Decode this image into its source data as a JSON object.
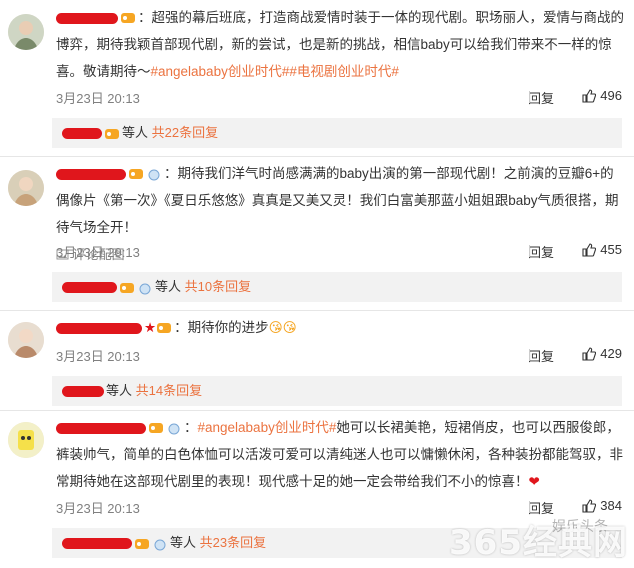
{
  "comments": [
    {
      "text_a": "：超强的幕后班底，打造商战爱情时装于一体的现代剧。职场丽人，爱情与商战的博弈，期待我颖首部现代剧，新的尝试，也是新的挑战，相信baby可以给我们带来不一样的惊喜。敬请期待～",
      "tags": [
        "#angelababy创业时代#",
        "#电视剧创业时代#"
      ],
      "time": "3月23日 20:13",
      "reply_label": "回复",
      "likes": "496",
      "reply_box": {
        "prefix": "等人",
        "count": "共22条回复"
      }
    },
    {
      "text_a": "：期待我们洋气时尚感满满的baby出演的第一部现代剧！之前演的豆瓣6+的偶像片《第一次》《夏日乐悠悠》真真是又美又灵！我们白富美那蓝小姐姐跟baby气质很搭，期待气场全开！",
      "pic_link": "评论配图",
      "time": "3月23日 20:13",
      "reply_label": "回复",
      "likes": "455",
      "reply_box": {
        "prefix": "等人",
        "count": "共10条回复"
      }
    },
    {
      "text_a": "：期待你的进步",
      "time": "3月23日 20:13",
      "reply_label": "回复",
      "likes": "429",
      "reply_box": {
        "prefix": "等人",
        "count": "共14条回复"
      }
    },
    {
      "tag": "#angelababy创业时代#",
      "text_b": "她可以长裙美艳，短裙俏皮，也可以西服俊郎，裤装帅气，简单的白色体恤可以活泼可爱可以清纯迷人也可以慵懒休闲，各种装扮都能驾驭，非常期待她在这部现代剧里的表现！现代感十足的她一定会带给我们不小的惊喜！",
      "time": "3月23日 20:13",
      "reply_label": "回复",
      "likes": "384",
      "reply_box": {
        "prefix": "等人",
        "count": "共23条回复"
      }
    }
  ],
  "watermark": "365经典网",
  "watermark_small": "娱乐头条",
  "colors": {
    "tag": "#eb7340",
    "redact": "#e0161c",
    "reply_bg": "#f2f2f2"
  }
}
